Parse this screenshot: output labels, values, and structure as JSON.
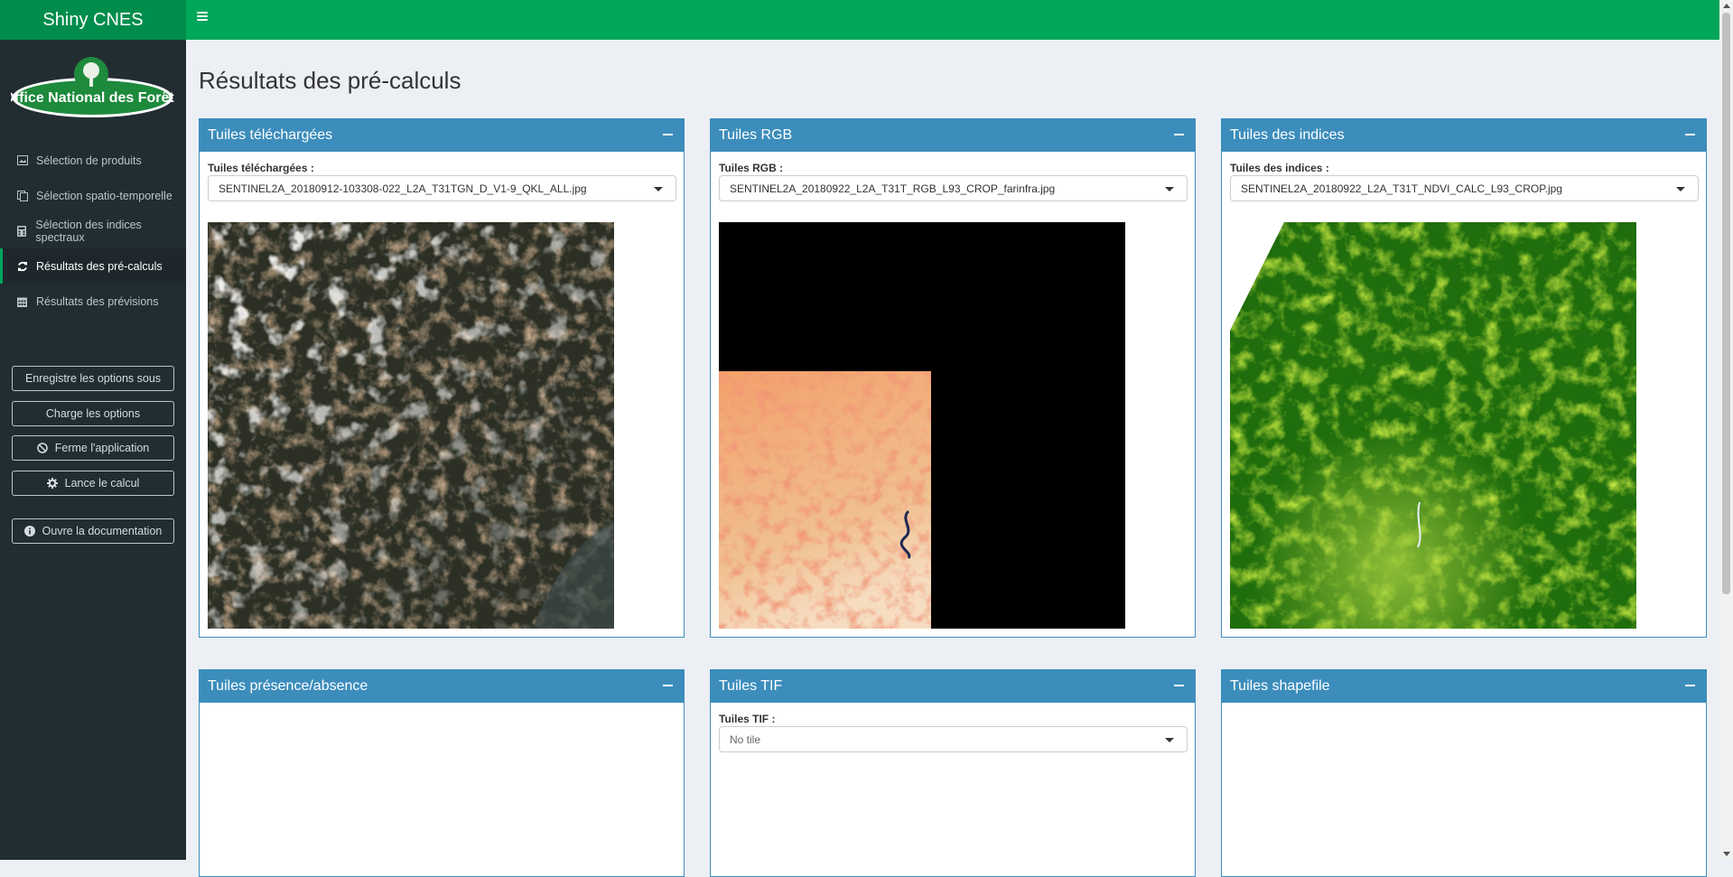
{
  "app": {
    "title": "Shiny CNES",
    "logo_text": "Office National des Forêts"
  },
  "sidebar": {
    "items": [
      {
        "label": "Sélection de produits",
        "icon": "image-icon"
      },
      {
        "label": "Sélection spatio-temporelle",
        "icon": "copy-icon"
      },
      {
        "label": "Sélection des indices spectraux",
        "icon": "calculator-icon"
      },
      {
        "label": "Résultats des pré-calculs",
        "icon": "refresh-icon",
        "active": true
      },
      {
        "label": "Résultats des prévisions",
        "icon": "calendar-icon"
      }
    ],
    "buttons": {
      "save_options": "Enregistre les options sous",
      "load_options": "Charge les options",
      "close_app": "Ferme l'application",
      "run": "Lance le calcul",
      "docs": "Ouvre la documentation"
    }
  },
  "page": {
    "title": "Résultats des pré-calculs"
  },
  "boxes": {
    "downloaded": {
      "title": "Tuiles téléchargées",
      "label": "Tuiles téléchargées :",
      "value": "SENTINEL2A_20180912-103308-022_L2A_T31TGN_D_V1-9_QKL_ALL.jpg"
    },
    "rgb": {
      "title": "Tuiles RGB",
      "label": "Tuiles RGB :",
      "value": "SENTINEL2A_20180922_L2A_T31T_RGB_L93_CROP_farinfra.jpg"
    },
    "indices": {
      "title": "Tuiles des indices",
      "label": "Tuiles des indices :",
      "value": "SENTINEL2A_20180922_L2A_T31T_NDVI_CALC_L93_CROP.jpg"
    },
    "presence": {
      "title": "Tuiles présence/absence"
    },
    "tif": {
      "title": "Tuiles TIF",
      "label": "Tuiles TIF :",
      "value": "No tile"
    },
    "shapefile": {
      "title": "Tuiles shapefile"
    }
  },
  "colors": {
    "header": "#00a65a",
    "logo_bar": "#008d4c",
    "sidebar": "#222d32",
    "box_header": "#3c8dbc",
    "content_bg": "#ecf0f5"
  }
}
